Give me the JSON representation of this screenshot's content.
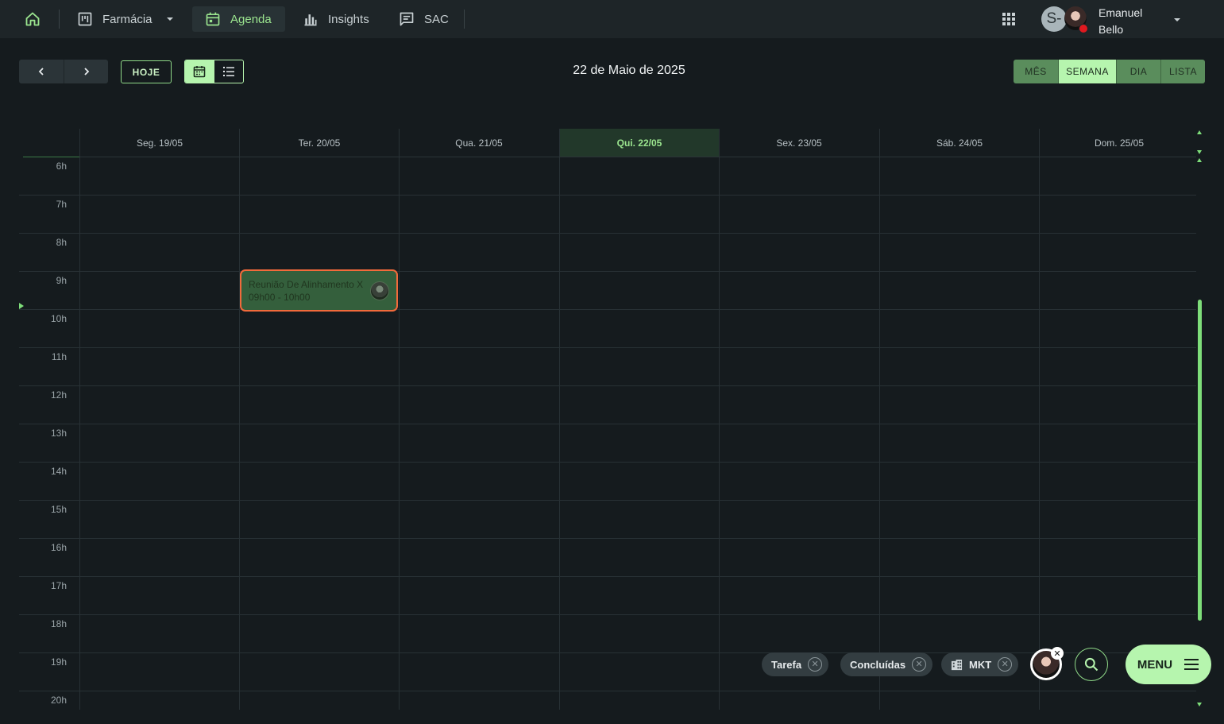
{
  "topnav": {
    "items": [
      {
        "label": "Farmácia",
        "icon": "board-icon"
      },
      {
        "label": "Agenda",
        "icon": "calendar-icon"
      },
      {
        "label": "Insights",
        "icon": "bar-chart-icon"
      },
      {
        "label": "SAC",
        "icon": "chat-icon"
      }
    ],
    "user": {
      "initial": "S-",
      "first_name": "Emanuel",
      "last_name": "Bello",
      "status_color": "#e0191f"
    }
  },
  "toolbar": {
    "today_label": "HOJE",
    "date_title": "22 de Maio de 2025",
    "range_tabs": [
      {
        "label": "MÊS",
        "active": false
      },
      {
        "label": "SEMANA",
        "active": true
      },
      {
        "label": "DIA",
        "active": false
      },
      {
        "label": "LISTA",
        "active": false
      }
    ]
  },
  "calendar": {
    "days": [
      {
        "label": "Seg. 19/05",
        "today": false
      },
      {
        "label": "Ter. 20/05",
        "today": false
      },
      {
        "label": "Qua. 21/05",
        "today": false
      },
      {
        "label": "Qui. 22/05",
        "today": true
      },
      {
        "label": "Sex. 23/05",
        "today": false
      },
      {
        "label": "Sáb. 24/05",
        "today": false
      },
      {
        "label": "Dom. 25/05",
        "today": false
      }
    ],
    "hours": [
      "6h",
      "7h",
      "8h",
      "9h",
      "10h",
      "11h",
      "12h",
      "13h",
      "14h",
      "15h",
      "16h",
      "17h",
      "18h",
      "19h",
      "20h"
    ],
    "event": {
      "title": "Reunião De Alinhamento X",
      "time": "09h00 - 10h00",
      "day": "Ter. 20/05"
    }
  },
  "filters": {
    "chips": [
      {
        "label": "Tarefa",
        "icon": null
      },
      {
        "label": "Concluídas",
        "icon": null
      },
      {
        "label": "MKT",
        "icon": "building-icon"
      }
    ]
  },
  "menu_label": "MENU",
  "colors": {
    "accent": "#b6f5ae",
    "accent_text": "#9be58f",
    "event_border": "#f26a3b",
    "event_bg": "#345f3c"
  }
}
